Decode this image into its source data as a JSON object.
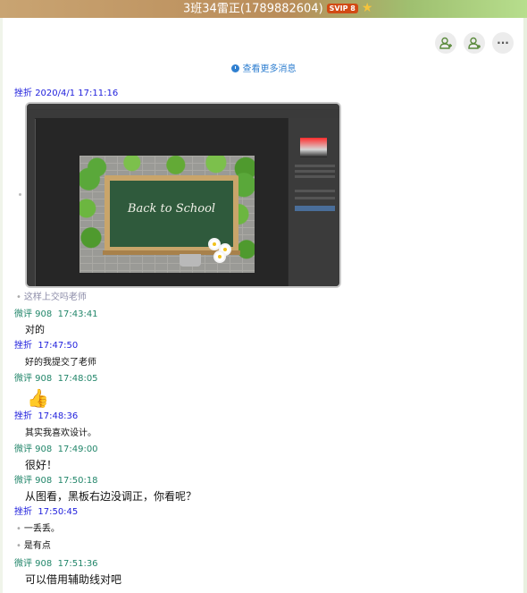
{
  "window": {
    "title": "3班34雷正(1789882604)",
    "badge": "SVIP 8",
    "icons": [
      "svip-badge",
      "star-icon"
    ]
  },
  "toolbar": {
    "buttons": [
      "add-member-icon",
      "group-info-icon",
      "more-icon"
    ],
    "more_label": "···"
  },
  "history_link": "查看更多消息",
  "image_message": {
    "board_text": "Back to School"
  },
  "messages": [
    {
      "sender": "挫折",
      "time": "2020/4/1 17:11:16"
    },
    {
      "bullet_text": "这样上交吗老师"
    },
    {
      "sender": "微评 908",
      "time": "17:43:41",
      "text": "对的"
    },
    {
      "sender": "挫折",
      "time": "17:47:50",
      "text": "好的我提交了老师"
    },
    {
      "sender": "微评 908",
      "time": "17:48:05",
      "emoji": "👍"
    },
    {
      "sender": "挫折",
      "time": "17:48:36",
      "text": "其实我喜欢设计。"
    },
    {
      "sender": "微评 908",
      "time": "17:49:00",
      "text": "很好！"
    },
    {
      "sender": "微评 908",
      "time": "17:50:18",
      "text": "从图看，黑板右边没调正，你看呢？"
    },
    {
      "sender": "挫折",
      "time": "17:50:45",
      "bullets": [
        "一丢丢。",
        "是有点"
      ]
    },
    {
      "sender": "微评 908",
      "time": "17:51:36",
      "text": "可以借用辅助线对吧"
    }
  ],
  "colors": {
    "sender_self": "#2222dd",
    "sender_teacher": "#22866a",
    "link": "#2f7fd0"
  }
}
